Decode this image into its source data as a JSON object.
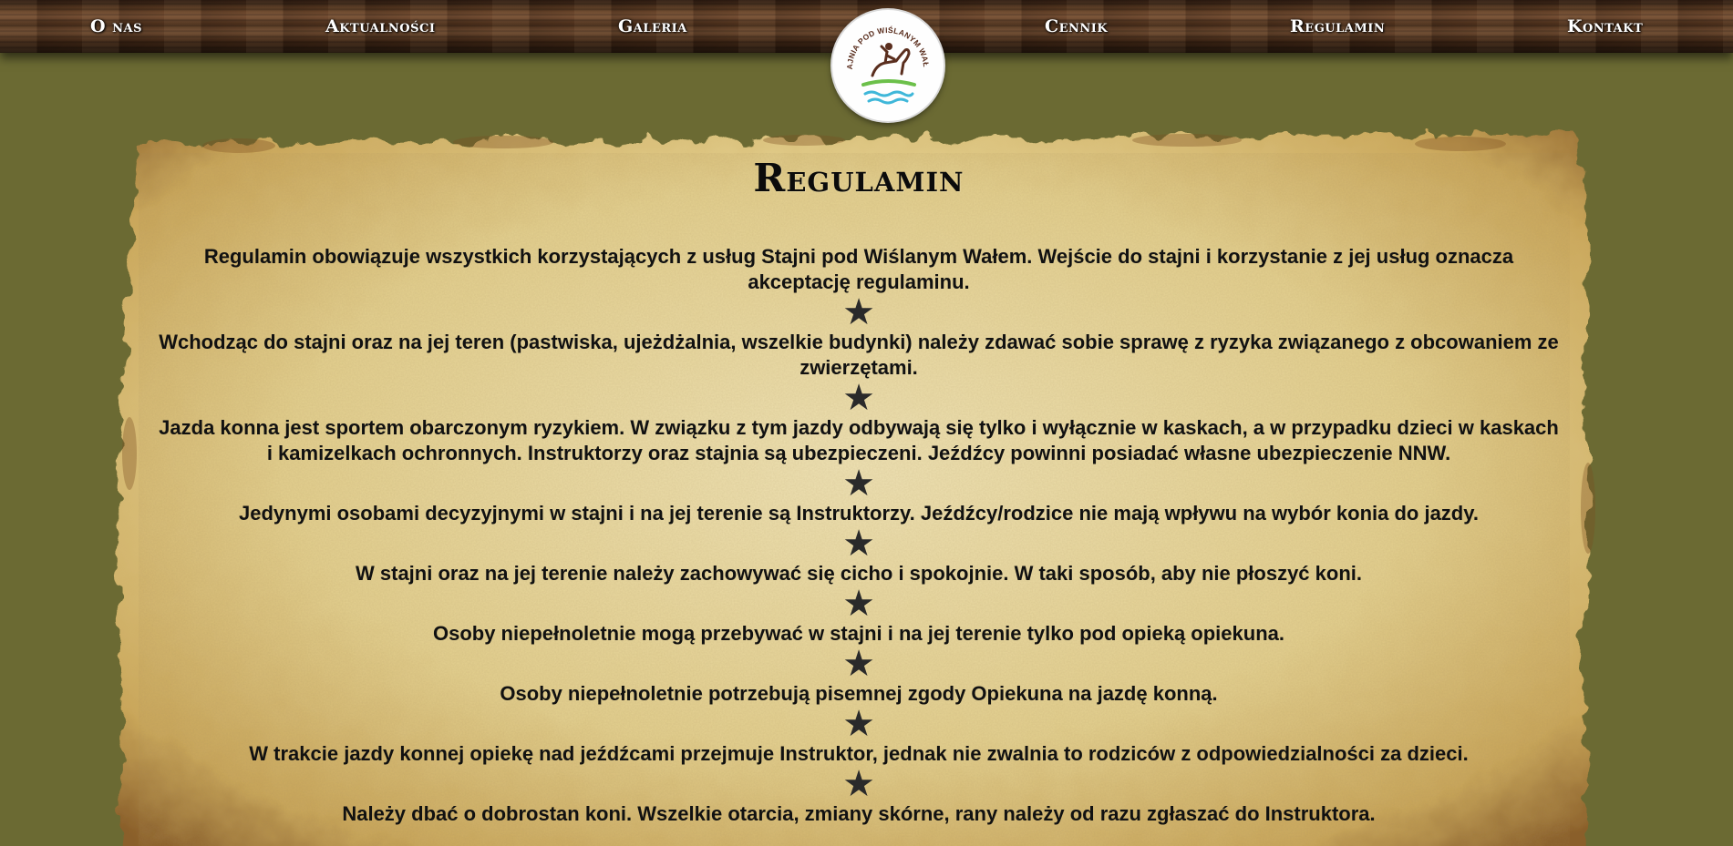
{
  "nav": {
    "items": [
      {
        "label": "O nas"
      },
      {
        "label": "Aktualności"
      },
      {
        "label": "Galeria"
      },
      {
        "label": "Cennik"
      },
      {
        "label": "Regulamin"
      },
      {
        "label": "Kontakt"
      }
    ]
  },
  "logo": {
    "text": "STAJNIA POD WIŚLANYM WAŁEM"
  },
  "main": {
    "title": "Regulamin",
    "rules": [
      "Regulamin obowiązuje wszystkich korzystających z usług Stajni pod Wiślanym Wałem. Wejście do stajni i korzystanie z jej usług oznacza akceptację regulaminu.",
      "Wchodząc do stajni oraz na jej teren (pastwiska, ujeżdżalnia, wszelkie budynki) należy zdawać sobie sprawę z ryzyka związanego z obcowaniem ze zwierzętami.",
      "Jazda konna jest sportem obarczonym ryzykiem. W związku z tym jazdy odbywają się tylko i wyłącznie w kaskach, a w przypadku dzieci w kaskach i kamizelkach ochronnych. Instruktorzy oraz stajnia są ubezpieczeni. Jeźdźcy powinni posiadać własne ubezpieczenie NNW.",
      "Jedynymi osobami decyzyjnymi w stajni i na jej terenie są Instruktorzy. Jeźdźcy/rodzice nie mają wpływu na wybór konia do jazdy.",
      "W stajni oraz na jej terenie należy zachowywać się cicho i spokojnie. W taki sposób, aby nie płoszyć koni.",
      "Osoby niepełnoletnie mogą przebywać w stajni i na jej terenie tylko pod opieką opiekuna.",
      "Osoby niepełnoletnie potrzebują pisemnej zgody Opiekuna na jazdę konną.",
      "W trakcie jazdy konnej opiekę nad jeźdźcami przejmuje Instruktor, jednak nie zwalnia to rodziców z odpowiedzialności za dzieci.",
      "Należy dbać o dobrostan koni. Wszelkie otarcia, zmiany skórne, rany należy od razu zgłaszać do Instruktora."
    ],
    "separator_icon": "star-icon"
  },
  "colors": {
    "background": "#6b6a33",
    "parchment": "#e6d59a",
    "text": "#111111",
    "logo_rider": "#5a2e1e",
    "logo_grass": "#6cc04a",
    "logo_water": "#3fb7d9"
  }
}
